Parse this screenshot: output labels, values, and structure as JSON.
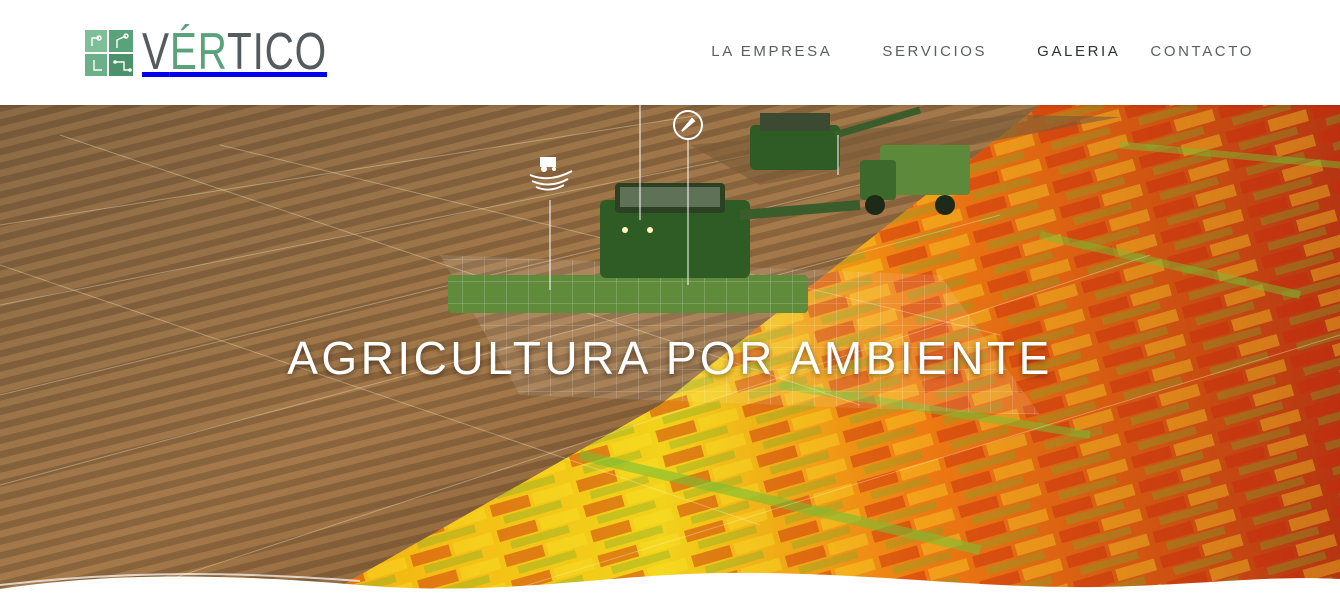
{
  "brand": {
    "name_prefix": "V",
    "name_accent": "ÉR",
    "name_suffix": "TICO",
    "logo_icon": "circuit-leaf-icon",
    "colors": {
      "green": "#5aa37a",
      "gray": "#555a5e"
    }
  },
  "nav": {
    "items": [
      {
        "label": "LA EMPRESA"
      },
      {
        "label": "SERVICIOS"
      },
      {
        "label": "GALERIA"
      },
      {
        "label": "CONTACTO"
      }
    ]
  },
  "hero": {
    "title": "AGRICULTURA POR AMBIENTE",
    "background_icons": [
      "compass-icon",
      "tractor-icon"
    ]
  }
}
